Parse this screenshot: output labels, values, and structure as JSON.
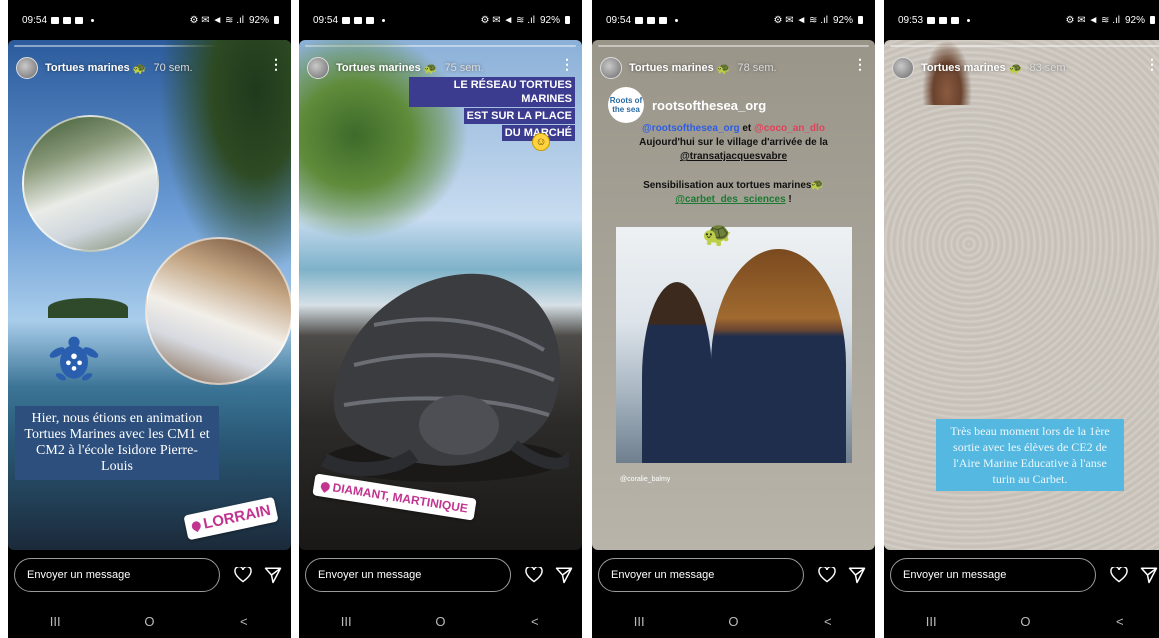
{
  "screens": [
    {
      "status": {
        "time": "09:54",
        "battery": "92%"
      },
      "header": {
        "username": "Tortues marines",
        "time_ago": "70 sem."
      },
      "caption": "Hier, nous étions en animation Tortues Marines avec les CM1 et CM2 à l'école Isidore Pierre-Louis",
      "location": "LORRAIN",
      "message_placeholder": "Envoyer un message"
    },
    {
      "status": {
        "time": "09:54",
        "battery": "92%"
      },
      "header": {
        "username": "Tortues marines",
        "time_ago": "75 sem."
      },
      "caption_lines": [
        "LE RÉSEAU TORTUES MARINES",
        "EST SUR LA PLACE",
        "DU MARCHÉ"
      ],
      "location": "DIAMANT, MARTINIQUE",
      "message_placeholder": "Envoyer un message"
    },
    {
      "status": {
        "time": "09:54",
        "battery": "92%"
      },
      "header": {
        "username": "Tortues marines",
        "time_ago": "78 sem."
      },
      "account": {
        "logo_text": "Roots of the sea",
        "name": "rootsofthesea_org"
      },
      "text": {
        "mention1": "@rootsofthesea_org",
        "and": " et ",
        "mention2": "@coco_an_dlo",
        "line2": "Aujourd'hui sur le village d'arrivée de la",
        "mention3": "@transatjacquesvabre",
        "line4": "Sensibilisation aux tortues marines",
        "mention4": "@carbet_des_sciences",
        "end": " !"
      },
      "credit": "@coralie_balmy",
      "message_placeholder": "Envoyer un message"
    },
    {
      "status": {
        "time": "09:53",
        "battery": "92%"
      },
      "header": {
        "username": "Tortues marines",
        "time_ago": "83 sem."
      },
      "caption": "Très beau moment lors de la 1ère sortie avec les élèves de CE2 de l'Aire Marine Educative à l'anse turin au Carbet.",
      "message_placeholder": "Envoyer un message"
    }
  ],
  "nav": {
    "recents": "III",
    "home": "O",
    "back": "<"
  },
  "icons": {
    "more": "more-vertical-icon",
    "heart": "heart-icon",
    "send": "send-icon",
    "turtle": "turtle-emoji-icon"
  },
  "colors": {
    "background": "#000000",
    "location_sticker": "#c1348f",
    "caption1_bg": "#2d4f7d",
    "caption4_bg": "#55b8e0",
    "mention_blue": "#2f5de0",
    "mention_red": "#e0405a"
  }
}
